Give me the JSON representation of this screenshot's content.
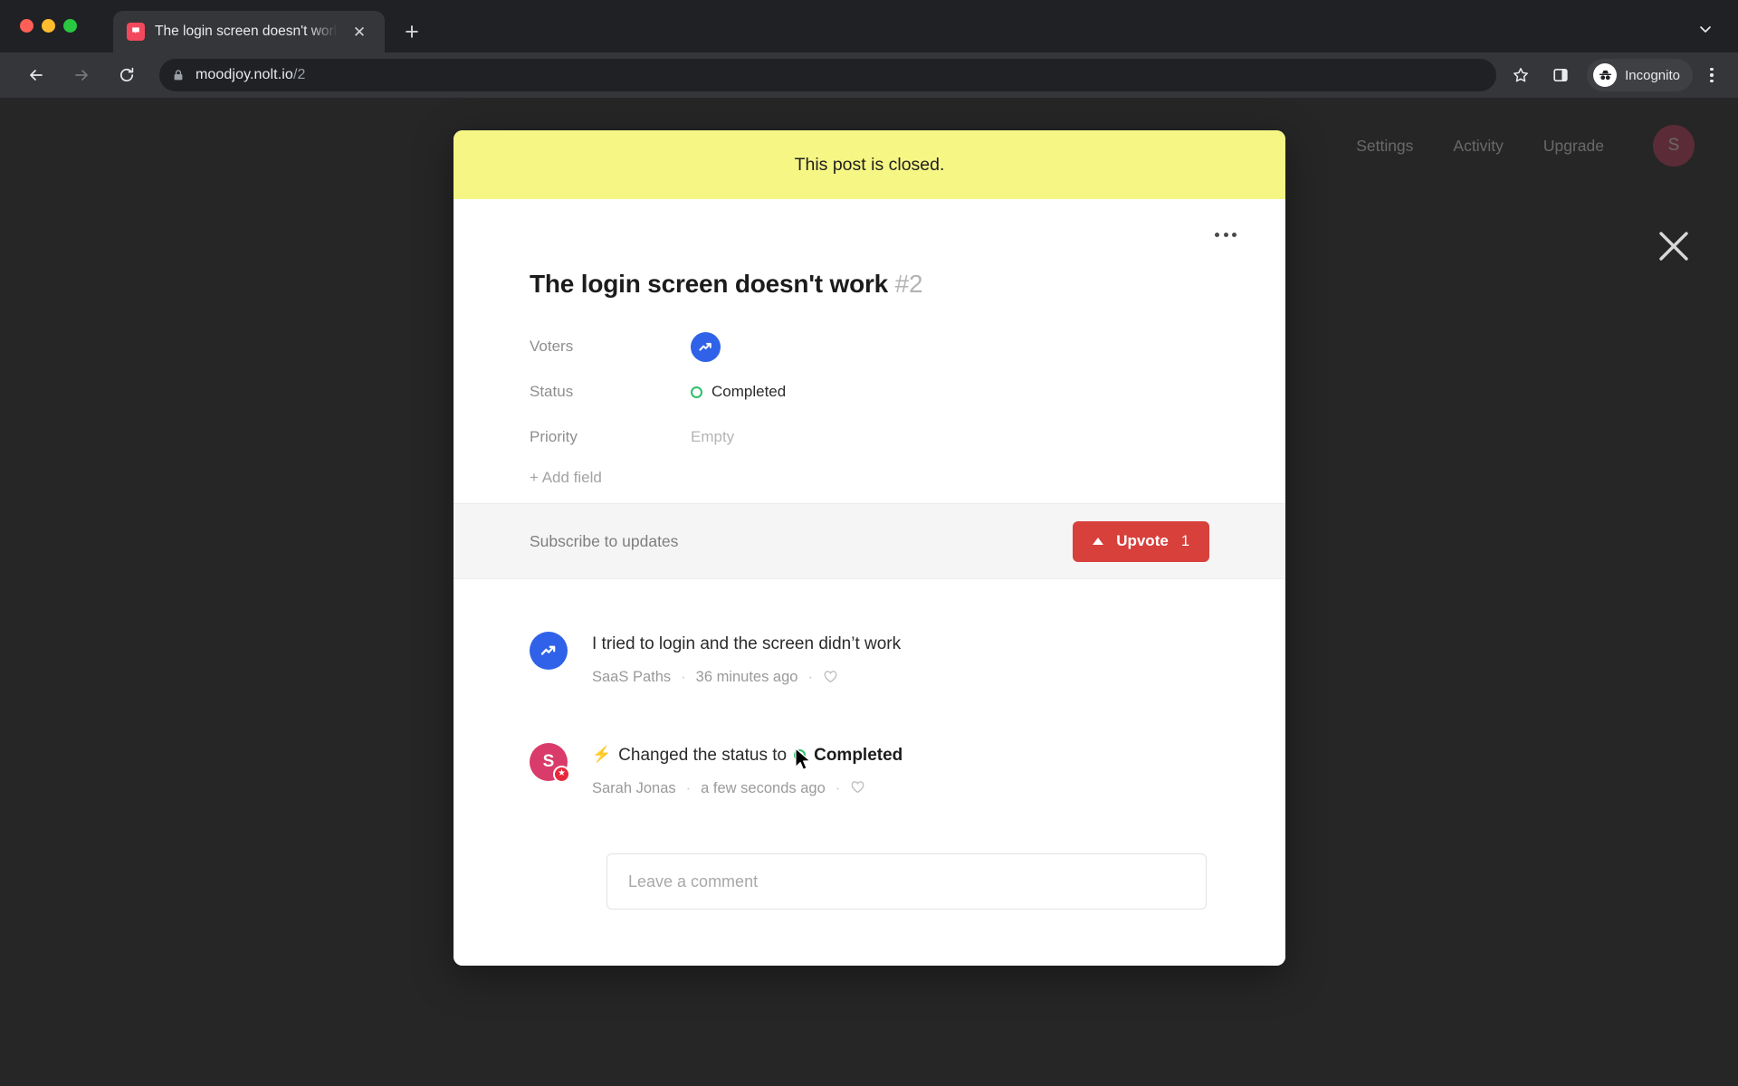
{
  "browser": {
    "tab": {
      "title": "The login screen doesn't work",
      "favicon": "nolt-flag-icon",
      "close_label": "✕"
    },
    "new_tab_label": "+",
    "tabstrip_chevron": "chevron-down-icon",
    "omnibox": {
      "url_host": "moodjoy.nolt.io",
      "url_path": "/2",
      "lock": "lock-icon"
    },
    "profile": {
      "label": "Incognito"
    },
    "icons": {
      "back": "back-arrow-icon",
      "forward": "forward-arrow-icon",
      "reload": "reload-icon",
      "bookmark": "star-icon",
      "side_panel": "side-panel-icon",
      "menu": "three-dot-menu-icon"
    }
  },
  "app_nav": {
    "links": [
      "Settings",
      "Activity",
      "Upgrade"
    ],
    "avatar_initial": "S",
    "close_overlay": "close-icon"
  },
  "modal": {
    "banner": {
      "text": "This post is closed.",
      "color": "#f6f684"
    },
    "overflow_menu": "more-options-icon",
    "title": "The login screen doesn't work",
    "post_number": "#2",
    "fields": [
      {
        "label": "Voters",
        "type": "avatars",
        "value": ""
      },
      {
        "label": "Status",
        "type": "status",
        "value": "Completed",
        "color": "#2bc06b"
      },
      {
        "label": "Priority",
        "type": "text",
        "value": "Empty"
      }
    ],
    "add_field_label": "+ Add field",
    "action_bar": {
      "subscribe_label": "Subscribe to updates",
      "upvote_label": "Upvote",
      "upvote_count": "1",
      "upvote_color": "#d8403c"
    },
    "feed": [
      {
        "kind": "comment",
        "avatar": "saas-paths-avatar",
        "avatar_style": "blue-trending-up",
        "text": "I tried to login and the screen didn’t work",
        "author": "SaaS Paths",
        "time": "36 minutes ago",
        "like": "heart-icon"
      },
      {
        "kind": "status-change",
        "avatar": "sarah-jonas-avatar",
        "avatar_style": "pink-initial",
        "avatar_initial": "S",
        "badge": "admin-star-badge",
        "prefix_icon": "⚡",
        "text": "Changed the status to",
        "status_value": "Completed",
        "status_color": "#2bc06b",
        "author": "Sarah Jonas",
        "time": "a few seconds ago",
        "like": "heart-icon"
      }
    ],
    "comment_input": {
      "placeholder": "Leave a comment",
      "value": ""
    }
  },
  "separator": "·"
}
